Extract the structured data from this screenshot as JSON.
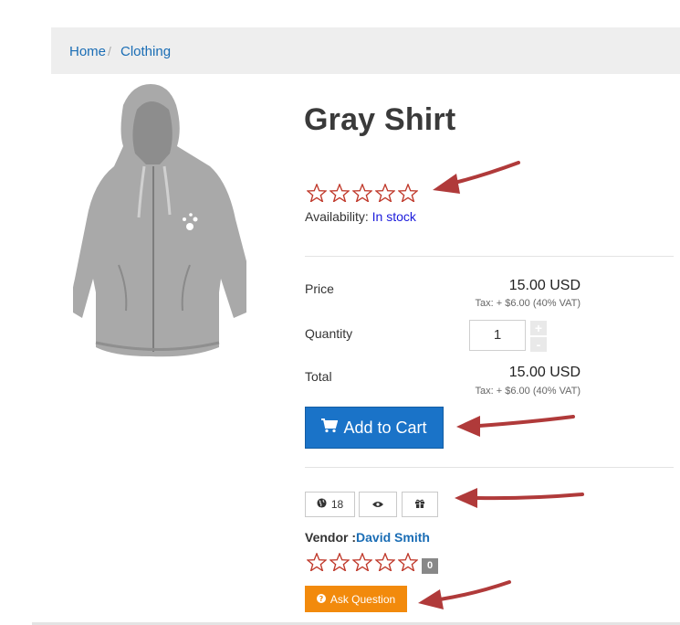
{
  "breadcrumb": {
    "home": "Home",
    "separator": "/",
    "category": "Clothing"
  },
  "product": {
    "title": "Gray Shirt",
    "rating": 0,
    "availability_label": "Availability:",
    "availability_value": "In stock",
    "image_icon": "hoodie-image"
  },
  "pricing": {
    "price_label": "Price",
    "price_value": "15.00 USD",
    "price_tax": "Tax: + $6.00 (40% VAT)",
    "quantity_label": "Quantity",
    "quantity_value": "1",
    "qty_plus": "+",
    "qty_minus": "-",
    "total_label": "Total",
    "total_value": "15.00 USD",
    "total_tax": "Tax: + $6.00 (40% VAT)"
  },
  "actions": {
    "add_to_cart": "Add to Cart",
    "cart_icon": "cart-icon",
    "globe_count": "18",
    "globe_icon": "globe-icon",
    "view_icon": "eye-icon",
    "gift_icon": "gift-icon",
    "ask_question": "Ask Question",
    "question_icon": "question-circle-icon"
  },
  "vendor": {
    "label": "Vendor :",
    "name": "David Smith",
    "rating": 0,
    "review_count": "0"
  },
  "colors": {
    "star_outline": "#c0392b",
    "link": "#1a6db5",
    "cart_button": "#1a73c8",
    "ask_button": "#f28a0c",
    "annotation_arrow": "#b03a3a"
  }
}
